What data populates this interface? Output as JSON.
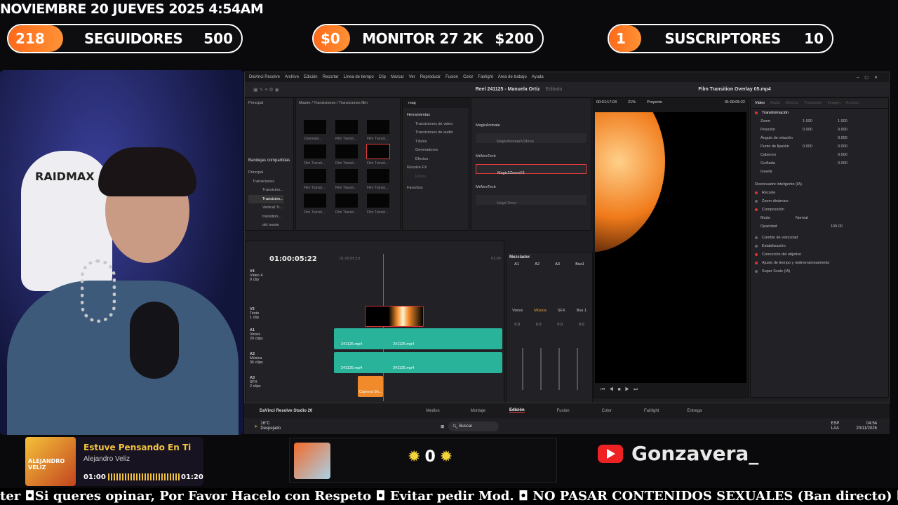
{
  "overlay": {
    "datetime": "NOVIEMBRE 20 JUEVES 2025 4:54AM",
    "goal_followers": {
      "current": "218",
      "label": "SEGUIDORES",
      "target": "500",
      "progress": 0.436
    },
    "goal_monitor": {
      "current": "$0",
      "label": "MONITOR 27 2K",
      "target": "$200",
      "progress": 0.0
    },
    "goal_subs": {
      "current": "1",
      "label": "SUSCRIPTORES",
      "target": "10",
      "progress": 0.1
    },
    "chair_brand": "RAIDMAX",
    "now_playing": {
      "title": "Estuve Pensando En Ti",
      "artist": "Alejandro Veliz",
      "elapsed": "01:00",
      "duration": "01:20",
      "cover_text": "ALEJANDRO VELIZ",
      "progress": 0.75
    },
    "counter": "0",
    "channel": "Gonzavera_",
    "ticker": "ter ◘Si queres opinar, Por Favor Hacelo con Respeto ◘ Evitar pedir Mod. ◘ NO PASAR CONTENIDOS SEXUALES (Ban directo) ◘ Evitar pedir VIP"
  },
  "resolve": {
    "menu": [
      "DaVinci Resolve",
      "Archivo",
      "Edición",
      "Recortar",
      "Línea de tiempo",
      "Clip",
      "Marcar",
      "Ver",
      "Reproducir",
      "Fusion",
      "Color",
      "Fairlight",
      "Área de trabajo",
      "Ayuda"
    ],
    "project_title": "Reel 241125 - Manuela Ortiz",
    "project_state": "Editado",
    "inspector_title": "Film Transition Overlay 05.mp4",
    "media_pool": {
      "root": "Principal",
      "shared": "Bandejas compartidas",
      "bins": [
        "Principal",
        "Transiciones",
        "Transicion...",
        "Transicion...",
        "Vertical Tr...",
        "transition...",
        "old movie"
      ],
      "path": "Master / Transiciones / Transiciones film",
      "thumbs": [
        "Cinematic...",
        "Film Transit...",
        "Film Transit...",
        "Film Transit...",
        "Film Transit...",
        "Film Transit...",
        "Film Transit...",
        "Film Transit...",
        "Film Transit...",
        "Film Transit...",
        "Film Transit...",
        "Film Transit..."
      ]
    },
    "effects": {
      "search": "mag",
      "tree": [
        "Herramientas",
        "Transiciones de video",
        "Transiciones de audio",
        "Títulos",
        "Generadores",
        "Efectos",
        "Resolve FX",
        "Filtros",
        "Favoritos"
      ],
      "groups": [
        {
          "name": "MagicAnimate",
          "items": [
            "MagicAnimateV3Free"
          ]
        },
        {
          "name": "MrAlexTech",
          "items": [
            "Magic2ZoomV3"
          ]
        },
        {
          "name": "MrAlexTech",
          "items": [
            "MagicTimer"
          ]
        }
      ]
    },
    "viewer": {
      "timecode_left": "00:01:17:03",
      "zoom": "21%",
      "label": "Proyecto",
      "timecode_right": "01:00:05:22"
    },
    "inspector": {
      "tabs": [
        "Video",
        "Audio",
        "Efectos",
        "Transición",
        "Imagen",
        "Archivo"
      ],
      "sections": [
        "Transformación",
        "Reencuadre inteligente (IA)",
        "Recorte",
        "Zoom dinámico",
        "Composición",
        "Cambio de velocidad",
        "Estabilización",
        "Corrección del objetivo",
        "Ajuste de tiempo y redimensionamiento",
        "Super Scale (IA)"
      ],
      "transform": [
        {
          "k": "Zoom",
          "x": "1.000",
          "y": "1.000"
        },
        {
          "k": "Posición",
          "x": "0.000",
          "y": "0.000"
        },
        {
          "k": "Ángulo de rotación",
          "x": "0.000"
        },
        {
          "k": "Punto de fijación",
          "x": "0.000",
          "y": "0.000"
        },
        {
          "k": "Cabeceo",
          "x": "0.000"
        },
        {
          "k": "Guiñada",
          "x": "0.000"
        },
        {
          "k": "Invertir",
          "x": ""
        }
      ],
      "mode_label": "Modo",
      "mode": "Normal",
      "opacity_label": "Opacidad",
      "opacity": "100.00"
    },
    "timeline": {
      "timecode": "01:00:05:22",
      "ruler": "01:00:05:10",
      "ruler_end": "01:00",
      "tracks": [
        {
          "id": "V4",
          "name": "Video 4",
          "sub": "0 clip"
        },
        {
          "id": "V3",
          "name": "Texto",
          "sub": "1 clip"
        },
        {
          "id": "A1",
          "name": "Voces",
          "sub": "20 clips"
        },
        {
          "id": "A2",
          "name": "Música",
          "sub": "36 clips"
        },
        {
          "id": "A3",
          "name": "SFX",
          "sub": "2 clips"
        }
      ],
      "clip_label": "241125.mp4",
      "sfx_clip": "Camera Sh..."
    },
    "mixer": {
      "title": "Mezclador",
      "channels": [
        "A1",
        "A2",
        "A3",
        "Bus1"
      ],
      "bottom": [
        "Voces",
        "Música",
        "SFX",
        "Bus 1"
      ],
      "level": "0.0"
    },
    "pages": [
      "Medios",
      "Montaje",
      "Edición",
      "Fusion",
      "Color",
      "Fairlight",
      "Entrega"
    ],
    "app_name": "DaVinci Resolve Studio 20",
    "taskbar": {
      "weather": "16°C",
      "weather_sub": "Despejado",
      "search": "Buscar",
      "lang": "ESP",
      "lang2": "LAA",
      "time": "04:54",
      "date": "20/11/2025"
    }
  },
  "colors": {
    "accent": "#ff7a22",
    "resolve_red": "#e23b3b",
    "audio_clip": "#29b39a"
  }
}
